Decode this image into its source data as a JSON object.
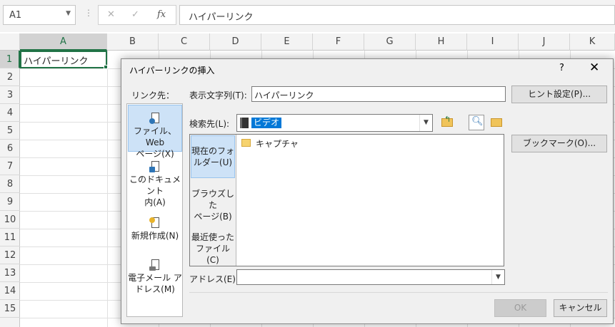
{
  "formula_bar": {
    "name_box": "A1",
    "fx_label": "fx",
    "formula": "ハイパーリンク"
  },
  "grid": {
    "columns": [
      "A",
      "B",
      "C",
      "D",
      "E",
      "F",
      "G",
      "H",
      "I",
      "J",
      "K"
    ],
    "rows": [
      "1",
      "2",
      "3",
      "4",
      "5",
      "6",
      "7",
      "8",
      "9",
      "10",
      "11",
      "12",
      "13",
      "14",
      "15"
    ],
    "selected_column": "A",
    "selected_row": "1",
    "cell_a1": "ハイパーリンク",
    "accent_color": "#217346"
  },
  "dialog": {
    "title": "ハイパーリンクの挿入",
    "help": "?",
    "close": "✕",
    "link_to_label": "リンク先：",
    "link_to": [
      {
        "line1": "ファイル、Web",
        "line2": "ページ(X)",
        "icon": "web-page-icon",
        "selected": true
      },
      {
        "line1": "このドキュメント",
        "line2": "内(A)",
        "icon": "document-icon",
        "selected": false
      },
      {
        "line1": "新規作成(N)",
        "line2": "",
        "icon": "new-document-icon",
        "selected": false
      },
      {
        "line1": "電子メール ア",
        "line2": "ドレス(M)",
        "icon": "email-icon",
        "selected": false
      }
    ],
    "display_text_label": "表示文字列(T):",
    "display_text_value": "ハイパーリンク",
    "screen_tip_button": "ヒント設定(P)...",
    "look_in_label": "検索先(L):",
    "look_in_value": "ビデオ",
    "bookmark_button": "ブックマーク(O)...",
    "look_tabs": [
      {
        "line1": "現在のフォ",
        "line2": "ルダー(U)",
        "selected": true
      },
      {
        "line1": "ブラウズした",
        "line2": "ページ(B)",
        "selected": false
      },
      {
        "line1": "最近使った",
        "line2": "ファイル(C)",
        "selected": false
      }
    ],
    "files": [
      "キャプチャ"
    ],
    "address_label": "アドレス(E):",
    "address_value": "",
    "ok_button": "OK",
    "cancel_button": "キャンセル",
    "selection_color": "#0078d7"
  }
}
